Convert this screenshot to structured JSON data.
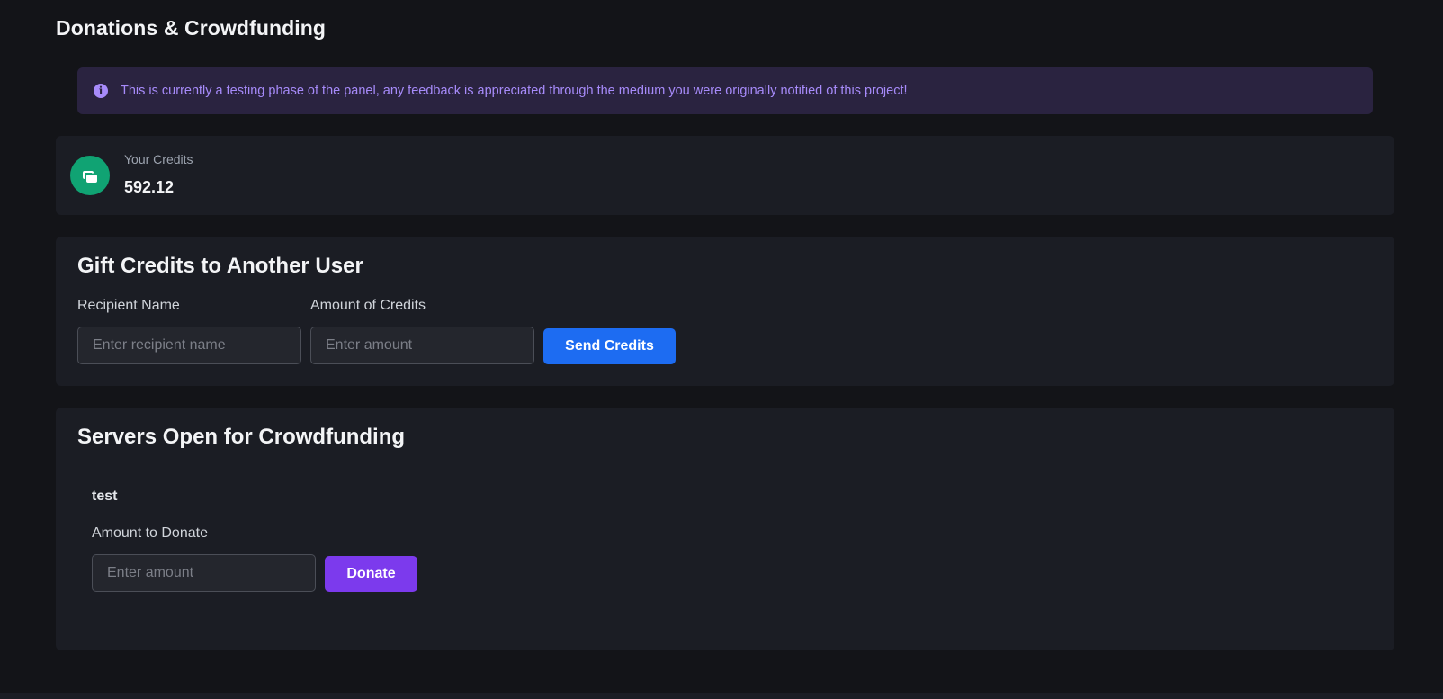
{
  "page": {
    "title": "Donations & Crowdfunding"
  },
  "alert": {
    "icon": "info-circle-icon",
    "text": "This is currently a testing phase of the panel, any feedback is appreciated through the medium you were originally notified of this project!",
    "color": "#a78bfa",
    "background": "#2a2340"
  },
  "credits": {
    "icon": "credit-cards-icon",
    "icon_color": "#10a373",
    "label": "Your Credits",
    "value": "592.12"
  },
  "gift": {
    "title": "Gift Credits to Another User",
    "recipient_label": "Recipient Name",
    "recipient_placeholder": "Enter recipient name",
    "recipient_value": "",
    "amount_label": "Amount of Credits",
    "amount_placeholder": "Enter amount",
    "amount_value": "",
    "send_label": "Send Credits",
    "send_color": "#1d6cf2"
  },
  "crowdfunding": {
    "title": "Servers Open for Crowdfunding",
    "servers": [
      {
        "name": "test",
        "amount_label": "Amount to Donate",
        "amount_placeholder": "Enter amount",
        "amount_value": "",
        "donate_label": "Donate",
        "donate_color": "#7c3aed"
      }
    ]
  }
}
